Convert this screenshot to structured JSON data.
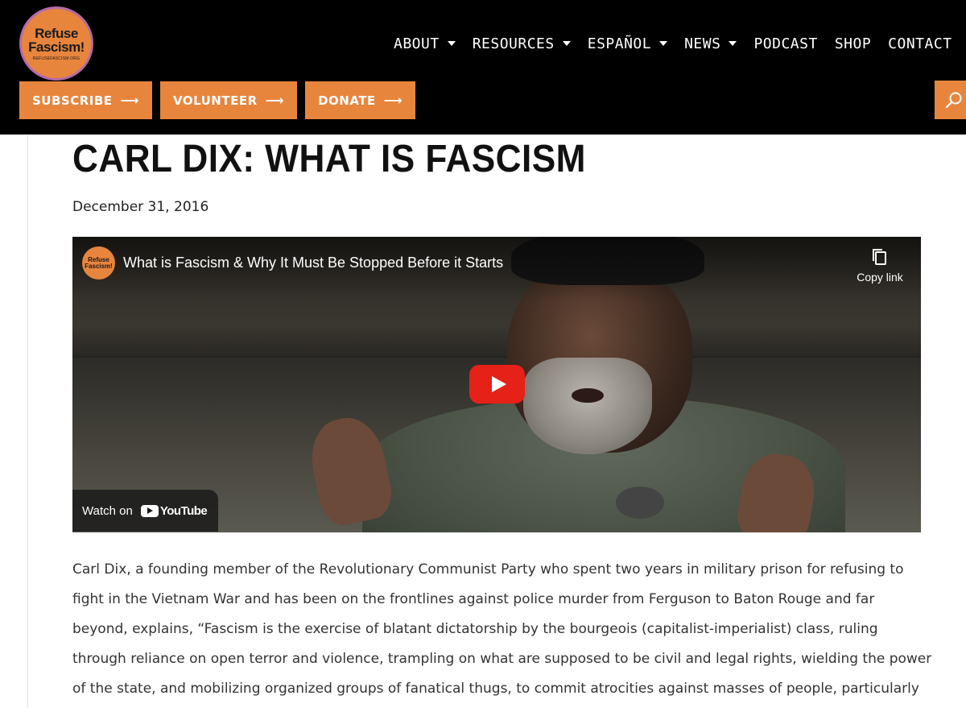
{
  "header": {
    "logo": {
      "line1": "Refuse",
      "line2": "Fascism!",
      "small": "REFUSEFASCISM.ORG"
    },
    "nav": [
      {
        "label": "ABOUT",
        "has_dropdown": true
      },
      {
        "label": "RESOURCES",
        "has_dropdown": true
      },
      {
        "label": "ESPAÑOL",
        "has_dropdown": true
      },
      {
        "label": "NEWS",
        "has_dropdown": true
      },
      {
        "label": "PODCAST",
        "has_dropdown": false
      },
      {
        "label": "SHOP",
        "has_dropdown": false
      },
      {
        "label": "CONTACT",
        "has_dropdown": false
      }
    ],
    "cta": [
      {
        "label": "SUBSCRIBE",
        "arrow": "⟶"
      },
      {
        "label": "VOLUNTEER",
        "arrow": "⟶"
      },
      {
        "label": "DONATE",
        "arrow": "⟶"
      }
    ],
    "search_icon": "search-icon"
  },
  "post": {
    "title": "CARL DIX: WHAT IS FASCISM",
    "date": "December 31, 2016",
    "video": {
      "title": "What is Fascism & Why It Must Be Stopped Before it Starts",
      "channel_avatar": {
        "line1": "Refuse",
        "line2": "Fascism!"
      },
      "copy_link_label": "Copy link",
      "watch_on_label": "Watch on",
      "youtube_label": "YouTube"
    },
    "body_lines": [
      "Carl Dix, a founding member of the Revolutionary Communist Party who spent two years in military prison for refusing to",
      "fight in the Vietnam War and has been on the frontlines against police murder from Ferguson to Baton Rouge and far",
      "beyond, explains, “Fascism is the exercise of blatant dictatorship by the bourgeois (capitalist-imperialist) class, ruling",
      "through reliance on open terror and violence, trampling on what are supposed to be civil and legal rights, wielding the power",
      "of the state, and mobilizing organized groups of fanatical thugs, to commit atrocities against masses of people, particularly"
    ]
  },
  "colors": {
    "header_bg": "#000000",
    "brand_orange": "#e8853d",
    "youtube_red": "#e62117",
    "text": "#333333"
  }
}
